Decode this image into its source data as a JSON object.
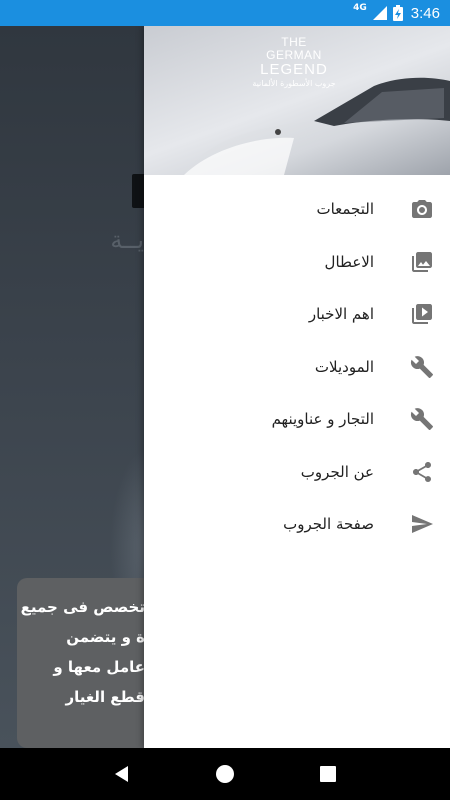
{
  "status_bar": {
    "network": "4G",
    "time": "3:46"
  },
  "background_screen": {
    "faded_title": "يــة",
    "info_card_lines": [
      "تخصص فى جميع",
      "ة و يتضمن",
      "عامل معها و",
      "قطع الغيار"
    ]
  },
  "drawer": {
    "header_logo": {
      "line1": "THE",
      "line2": "GERMAN",
      "line3": "LEGEND",
      "subtitle": "جروب الأسطورة الألمانية"
    },
    "items": [
      {
        "label": "التجمعات",
        "icon": "camera-icon"
      },
      {
        "label": "الاعطال",
        "icon": "photo-library-icon"
      },
      {
        "label": "اهم الاخبار",
        "icon": "video-library-icon"
      },
      {
        "label": "الموديلات",
        "icon": "wrench-icon"
      },
      {
        "label": "التجار و عناوينهم",
        "icon": "wrench-icon"
      },
      {
        "label": "عن الجروب",
        "icon": "share-icon"
      },
      {
        "label": "صفحة الجروب",
        "icon": "send-icon"
      }
    ]
  },
  "colors": {
    "status_bar": "#1b8fe0",
    "icon": "#757575",
    "drawer_bg": "#ffffff"
  }
}
